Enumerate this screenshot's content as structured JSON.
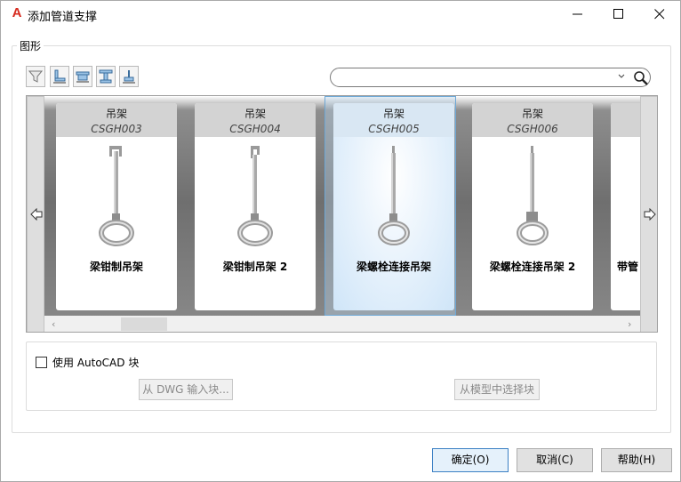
{
  "window": {
    "title": "添加管道支撑",
    "app_icon": "autocad-logo-icon",
    "controls": [
      "minimize-icon",
      "maximize-icon",
      "close-icon"
    ]
  },
  "figure_group": {
    "label": "图形",
    "filter_buttons": [
      "filter-icon",
      "support-type-1-icon",
      "support-type-2-icon",
      "support-type-3-icon",
      "support-type-4-icon"
    ],
    "search": {
      "value": "",
      "placeholder": ""
    }
  },
  "gallery": {
    "cards": [
      {
        "category": "吊架",
        "code": "CSGH003",
        "name": "梁钳制吊架"
      },
      {
        "category": "吊架",
        "code": "CSGH004",
        "name": "梁钳制吊架 2"
      },
      {
        "category": "吊架",
        "code": "CSGH005",
        "name": "梁螺栓连接吊架",
        "selected": true
      },
      {
        "category": "吊架",
        "code": "CSGH006",
        "name": "梁螺栓连接吊架 2"
      },
      {
        "category": "",
        "code": "",
        "name": "带管"
      }
    ]
  },
  "block_group": {
    "checkbox_label": "使用 AutoCAD 块",
    "checked": false,
    "import_dwg_button": "从 DWG 输入块...",
    "select_model_button": "从模型中选择块"
  },
  "footer": {
    "ok": "确定(O)",
    "cancel": "取消(C)",
    "help": "帮助(H)"
  },
  "colors": {
    "accent": "#3c80c4",
    "selection": "#cfe5f8",
    "app_icon": "#d62a1e"
  }
}
